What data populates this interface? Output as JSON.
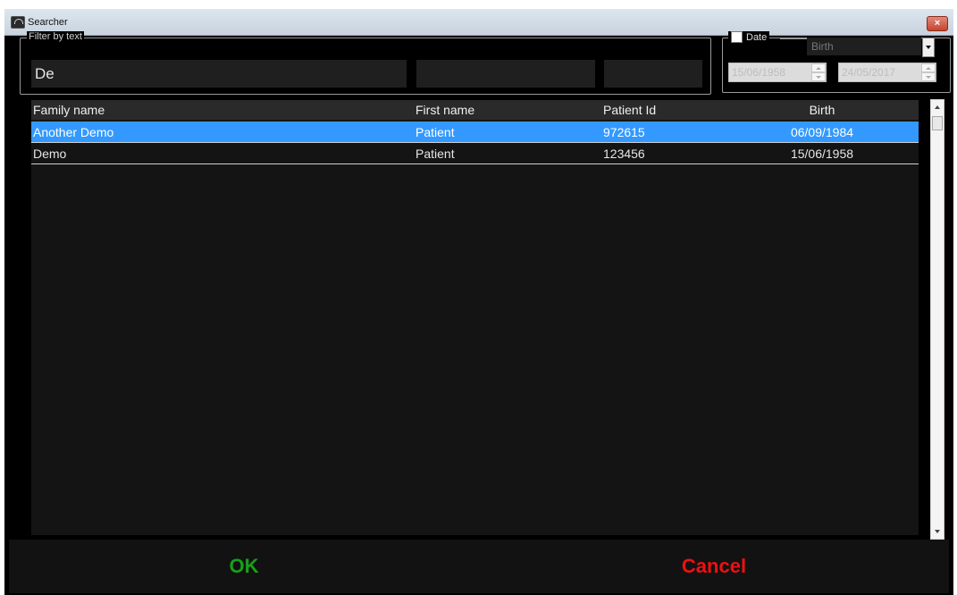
{
  "window": {
    "title": "Searcher",
    "close_glyph": "×"
  },
  "filter": {
    "legend": "Filter by text",
    "family_name_value": "De",
    "first_name_value": "",
    "patient_id_value": ""
  },
  "date_filter": {
    "checkbox_label": "Date",
    "checked": false,
    "field_selected": "Birth",
    "from_date": "15/06/1958",
    "to_date": "24/05/2017"
  },
  "table": {
    "columns": [
      "Family name",
      "First name",
      "Patient Id",
      "Birth"
    ],
    "rows": [
      {
        "family_name": "Another Demo",
        "first_name": "Patient",
        "patient_id": "972615",
        "birth": "06/09/1984",
        "selected": true
      },
      {
        "family_name": "Demo",
        "first_name": "Patient",
        "patient_id": "123456",
        "birth": "15/06/1958",
        "selected": false
      }
    ]
  },
  "footer": {
    "ok_label": "OK",
    "cancel_label": "Cancel"
  },
  "colors": {
    "selected_row": "#3399ff",
    "ok": "#18a018",
    "cancel": "#ee1010",
    "background": "#000000"
  },
  "icons": {
    "app": "searcher-app-icon",
    "close": "close-icon",
    "dropdown": "chevron-down-icon",
    "spin_up": "spin-up-icon",
    "spin_down": "spin-down-icon"
  }
}
